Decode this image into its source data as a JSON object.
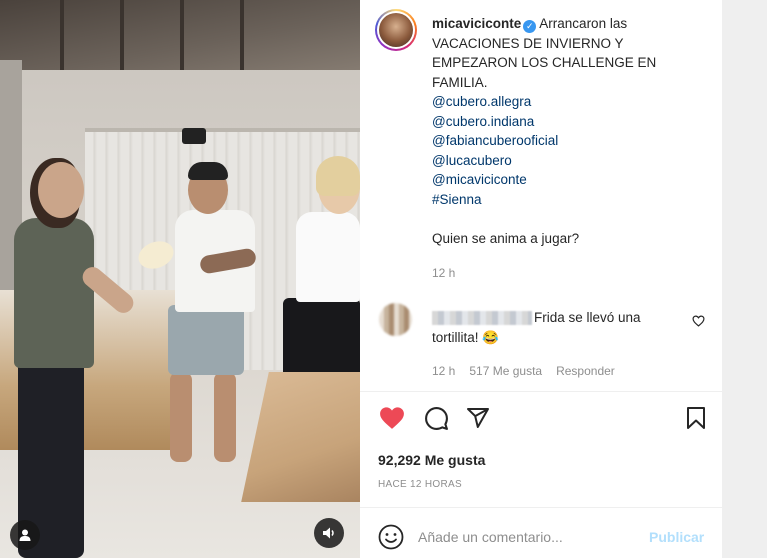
{
  "post": {
    "username": "micaviciconte",
    "caption_lines": [
      "Arrancaron las",
      "VACACIONES DE INVIERNO Y",
      "EMPEZARON LOS CHALLENGE EN",
      "FAMILIA."
    ],
    "mentions": [
      "@cubero.allegra",
      "@cubero.indiana",
      "@fabiancuberooficial",
      "@lucacubero",
      "@micaviciconte",
      "#Sienna"
    ],
    "question": "Quien se anima a jugar?",
    "caption_time": "12 h"
  },
  "comment": {
    "text": "Frida se llevó una tortillita! 😂",
    "time": "12 h",
    "likes": "517 Me gusta",
    "reply": "Responder"
  },
  "likes_count": "92,292 Me gusta",
  "post_time": "HACE 12 HORAS",
  "comment_box": {
    "placeholder": "Añade un comentario...",
    "publish": "Publicar"
  },
  "colors": {
    "heart": "#ed4956",
    "link": "#00376b",
    "publish_disabled": "#b2dffc"
  },
  "icons": [
    "user-tag-icon",
    "sound-icon",
    "heart-icon",
    "comment-icon",
    "share-icon",
    "save-icon",
    "emoji-icon",
    "comment-heart-icon",
    "verified-icon"
  ]
}
